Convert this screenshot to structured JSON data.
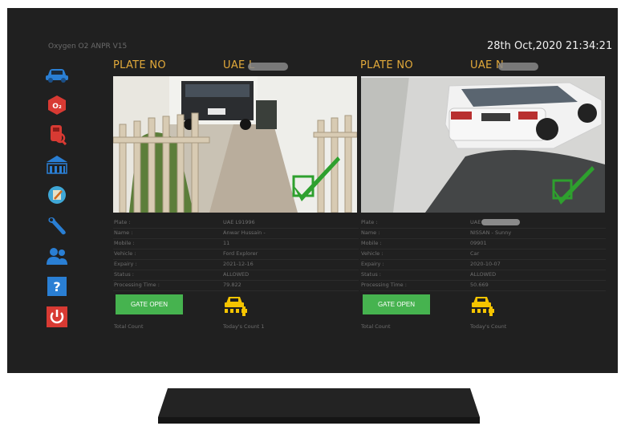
{
  "app": {
    "title": "Oxygen O2 ANPR V15",
    "datetime": "28th Oct,2020 21:34:21"
  },
  "sidebar": {
    "icons": [
      "car-icon",
      "o2-logo-icon",
      "vehicle-search-icon",
      "building-icon",
      "edit-icon",
      "wrench-icon",
      "users-icon",
      "help-icon",
      "power-icon"
    ],
    "o2_text": "O₂",
    "help_text": "?"
  },
  "panels": [
    {
      "plate_no_label": "PLATE NO",
      "plate_no_value": "UAE L",
      "fields": [
        {
          "label": "Plate :",
          "value": "UAE L91996"
        },
        {
          "label": "Name :",
          "value": "Anwar Hussain -"
        },
        {
          "label": "Mobile :",
          "value": "11"
        },
        {
          "label": "Vehicle :",
          "value": "Ford Explorer"
        },
        {
          "label": "Expairy :",
          "value": "2021-12-16"
        },
        {
          "label": "Status :",
          "value": "ALLOWED"
        },
        {
          "label": "Processing Time :",
          "value": "79.822"
        }
      ],
      "gate_button": "GATE OPEN",
      "total_count_label": "Total Count",
      "todays_count_label": "Today's Count 1"
    },
    {
      "plate_no_label": "PLATE NO",
      "plate_no_value": "UAE N",
      "fields": [
        {
          "label": "Plate :",
          "value": "UAE"
        },
        {
          "label": "Name :",
          "value": "NISSAN - Sunny"
        },
        {
          "label": "Mobile :",
          "value": "09901"
        },
        {
          "label": "Vehicle :",
          "value": "Car"
        },
        {
          "label": "Expairy :",
          "value": "2020-10-07"
        },
        {
          "label": "Status :",
          "value": "ALLOWED"
        },
        {
          "label": "Processing Time :",
          "value": "50.669"
        }
      ],
      "gate_button": "GATE OPEN",
      "total_count_label": "Total Count",
      "todays_count_label": "Today's Count"
    }
  ],
  "colors": {
    "accent": "#e2a93a",
    "gate_button": "#46b34f",
    "check": "#2ea02e",
    "sidebar_blue": "#2a7fd4",
    "sidebar_red": "#d83a33"
  }
}
